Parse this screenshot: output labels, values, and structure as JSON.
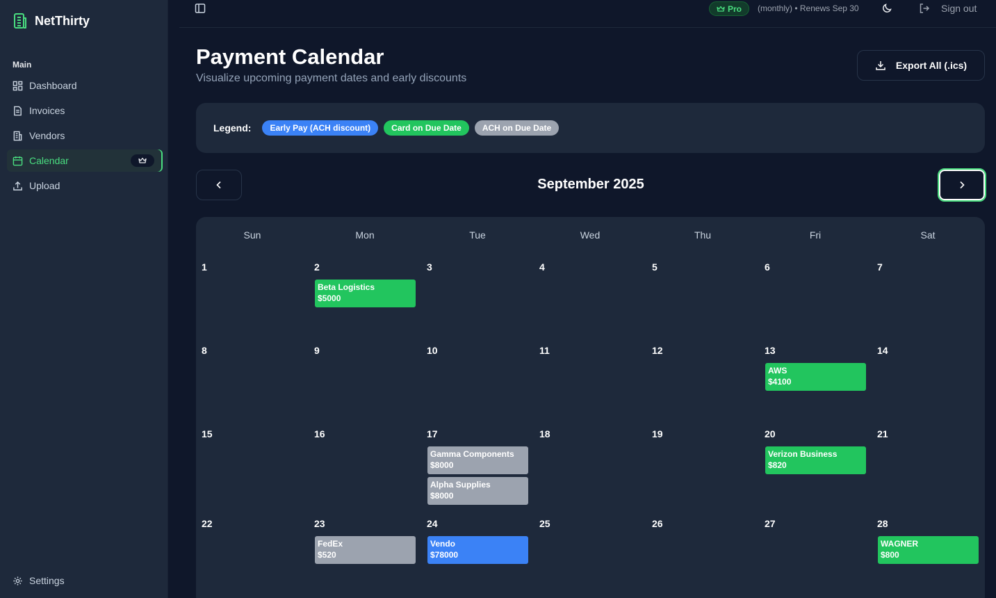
{
  "app": {
    "name": "NetThirty"
  },
  "sidebar": {
    "section": "Main",
    "items": [
      {
        "label": "Dashboard",
        "icon": "dashboard-icon"
      },
      {
        "label": "Invoices",
        "icon": "document-icon"
      },
      {
        "label": "Vendors",
        "icon": "building-icon"
      },
      {
        "label": "Calendar",
        "icon": "calendar-icon",
        "active": true,
        "badge_icon": "crown-icon"
      },
      {
        "label": "Upload",
        "icon": "upload-icon"
      }
    ],
    "settings_label": "Settings"
  },
  "topbar": {
    "plan": "Pro",
    "renewal": "(monthly) • Renews Sep 30",
    "signout_label": "Sign out"
  },
  "page": {
    "title": "Payment Calendar",
    "subtitle": "Visualize upcoming payment dates and early discounts",
    "export_label": "Export All (.ics)"
  },
  "legend": {
    "label": "Legend:",
    "items": [
      {
        "label": "Early Pay (ACH discount)",
        "color": "#3b82f6"
      },
      {
        "label": "Card on Due Date",
        "color": "#22c55e"
      },
      {
        "label": "ACH on Due Date",
        "color": "#9ca3af"
      }
    ]
  },
  "calendar": {
    "month_label": "September 2025",
    "weekdays": [
      "Sun",
      "Mon",
      "Tue",
      "Wed",
      "Thu",
      "Fri",
      "Sat"
    ],
    "weeks": [
      [
        {
          "day": "1",
          "events": []
        },
        {
          "day": "2",
          "events": [
            {
              "name": "Beta Logistics",
              "amount": "$5000",
              "type": "card"
            }
          ]
        },
        {
          "day": "3",
          "events": []
        },
        {
          "day": "4",
          "events": []
        },
        {
          "day": "5",
          "events": []
        },
        {
          "day": "6",
          "events": []
        },
        {
          "day": "7",
          "events": []
        }
      ],
      [
        {
          "day": "8",
          "events": []
        },
        {
          "day": "9",
          "events": []
        },
        {
          "day": "10",
          "events": []
        },
        {
          "day": "11",
          "events": []
        },
        {
          "day": "12",
          "events": []
        },
        {
          "day": "13",
          "events": [
            {
              "name": "AWS",
              "amount": "$4100",
              "type": "card"
            }
          ]
        },
        {
          "day": "14",
          "events": []
        }
      ],
      [
        {
          "day": "15",
          "events": []
        },
        {
          "day": "16",
          "events": []
        },
        {
          "day": "17",
          "events": [
            {
              "name": "Gamma Components",
              "amount": "$8000",
              "type": "ach"
            },
            {
              "name": "Alpha Supplies",
              "amount": "$8000",
              "type": "ach"
            }
          ]
        },
        {
          "day": "18",
          "events": []
        },
        {
          "day": "19",
          "events": []
        },
        {
          "day": "20",
          "events": [
            {
              "name": "Verizon Business",
              "amount": "$820",
              "type": "card"
            }
          ]
        },
        {
          "day": "21",
          "events": []
        }
      ],
      [
        {
          "day": "22",
          "events": []
        },
        {
          "day": "23",
          "events": [
            {
              "name": "FedEx",
              "amount": "$520",
              "type": "ach"
            }
          ]
        },
        {
          "day": "24",
          "events": [
            {
              "name": "Vendo",
              "amount": "$78000",
              "type": "early"
            }
          ]
        },
        {
          "day": "25",
          "events": []
        },
        {
          "day": "26",
          "events": []
        },
        {
          "day": "27",
          "events": []
        },
        {
          "day": "28",
          "events": [
            {
              "name": "WAGNER",
              "amount": "$800",
              "type": "card"
            }
          ]
        }
      ]
    ]
  },
  "colors": {
    "early": "#3b82f6",
    "card": "#22c55e",
    "ach": "#9ca3af",
    "accent": "#4ade80"
  }
}
